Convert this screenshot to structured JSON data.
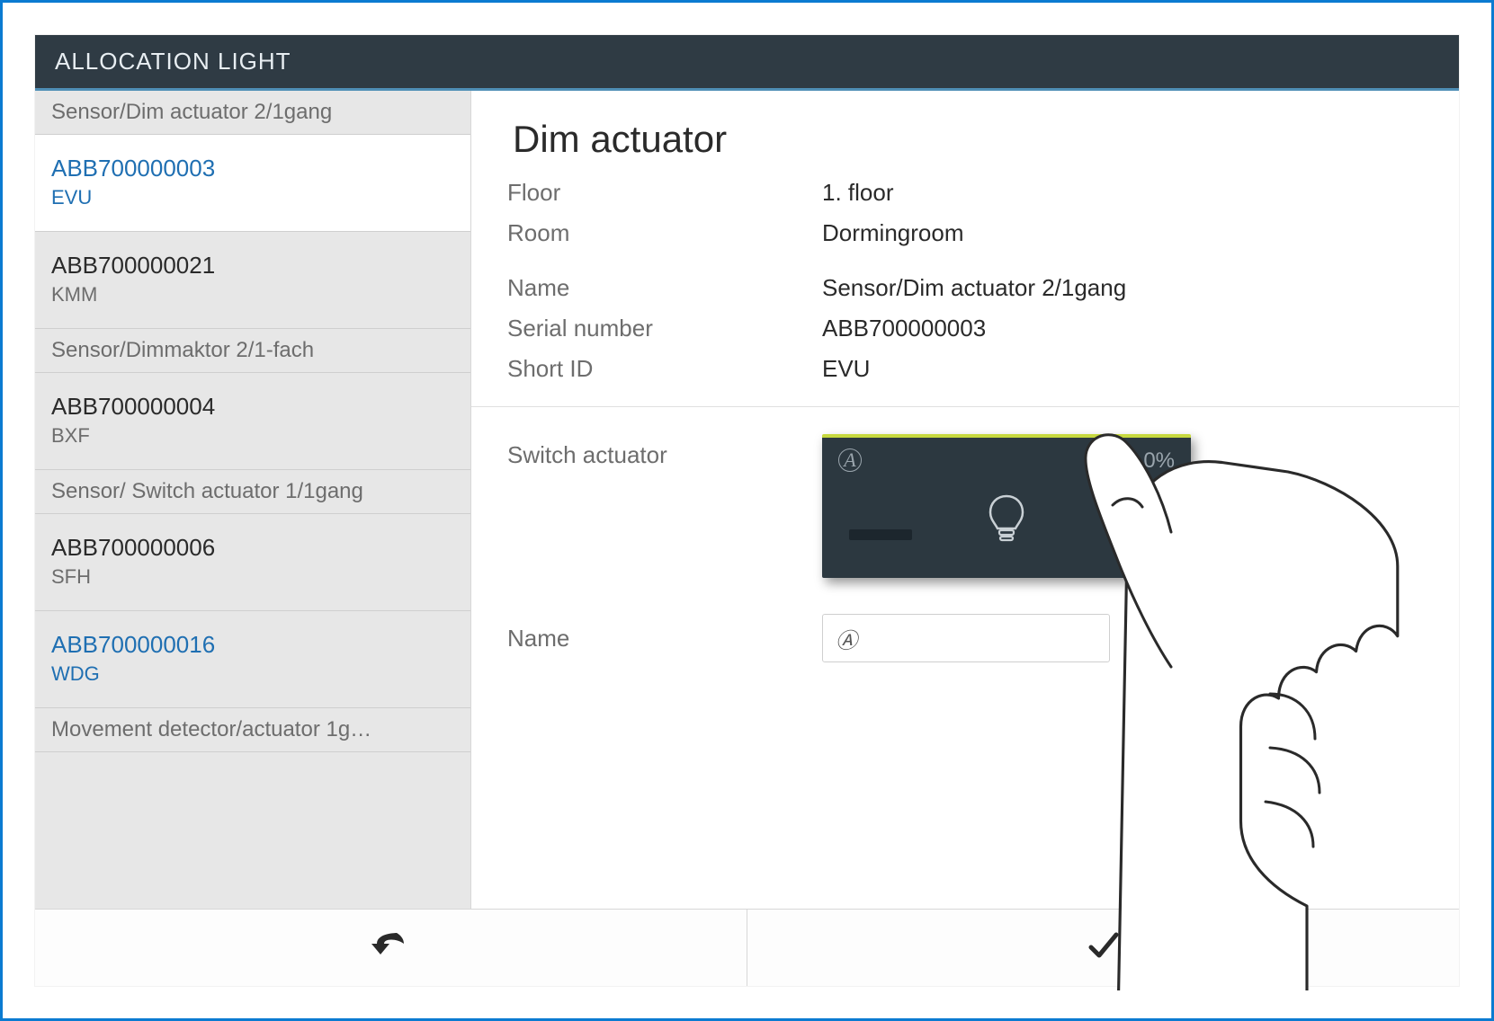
{
  "titlebar": "ALLOCATION LIGHT",
  "sidebar": {
    "groups": [
      {
        "header": "Sensor/Dim actuator 2/1gang",
        "items": [
          {
            "serial": "ABB700000003",
            "short": "EVU",
            "selected": true,
            "link": true
          },
          {
            "serial": "ABB700000021",
            "short": "KMM",
            "selected": false,
            "link": false
          }
        ]
      },
      {
        "header": "Sensor/Dimmaktor 2/1-fach",
        "items": [
          {
            "serial": "ABB700000004",
            "short": "BXF",
            "selected": false,
            "link": false
          }
        ]
      },
      {
        "header": "Sensor/ Switch actuator 1/1gang",
        "items": [
          {
            "serial": "ABB700000006",
            "short": "SFH",
            "selected": false,
            "link": false
          },
          {
            "serial": "ABB700000016",
            "short": "WDG",
            "selected": false,
            "link": true
          }
        ]
      },
      {
        "header": "Movement detector/actuator 1g…",
        "items": []
      }
    ]
  },
  "details": {
    "title": "Dim actuator",
    "rows": {
      "floor_label": "Floor",
      "floor_value": "1. floor",
      "room_label": "Room",
      "room_value": "Dormingroom",
      "name_label": "Name",
      "name_value": "Sensor/Dim actuator 2/1gang",
      "serial_label": "Serial number",
      "serial_value": "ABB700000003",
      "shortid_label": "Short ID",
      "shortid_value": "EVU"
    },
    "switch": {
      "label": "Switch actuator",
      "badge": "A",
      "percent": "0%"
    },
    "channel_name": {
      "label": "Name",
      "value": "Ⓐ"
    }
  }
}
